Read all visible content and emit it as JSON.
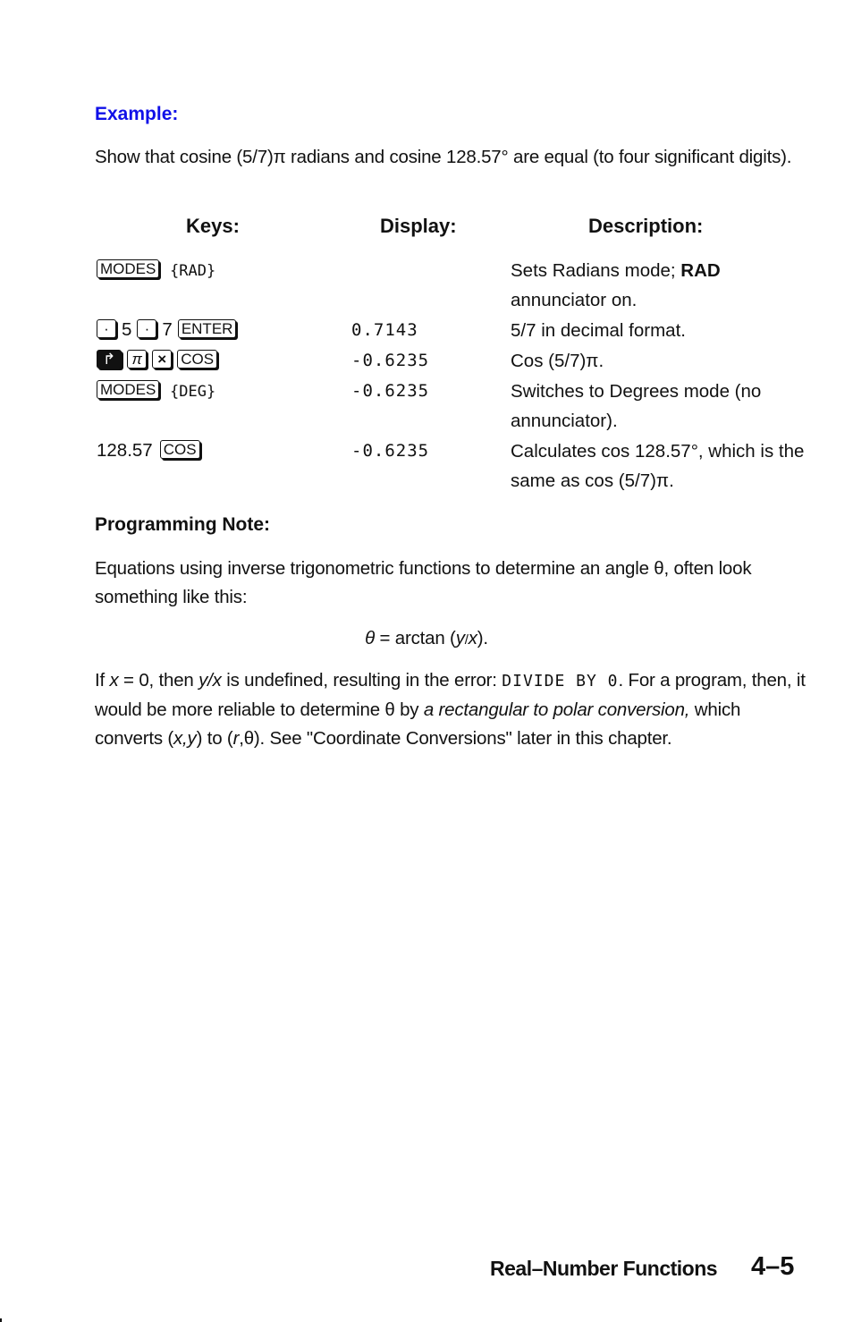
{
  "example": {
    "heading": "Example:",
    "intro": "Show that cosine (5/7)π radians and cosine 128.57° are equal (to four significant digits).",
    "accent_color": "#1010e8"
  },
  "table": {
    "headers": {
      "keys": "Keys:",
      "display": "Display:",
      "description": "Description:"
    },
    "rows": [
      {
        "keys": [
          {
            "type": "keycap",
            "label": "MODES"
          },
          {
            "type": "softkey",
            "label": "{RAD}"
          }
        ],
        "display": "",
        "description_pre": "Sets Radians mode; ",
        "description_bold": "RAD",
        "description_post": " annunciator on."
      },
      {
        "keys": [
          {
            "type": "keycap",
            "label": "·"
          },
          {
            "type": "text",
            "label": "5"
          },
          {
            "type": "keycap",
            "label": "·"
          },
          {
            "type": "text",
            "label": "7"
          },
          {
            "type": "keycap",
            "label": "ENTER"
          }
        ],
        "display": "0.7143",
        "description": "5/7 in decimal format."
      },
      {
        "keys": [
          {
            "type": "keycap-shift",
            "label": "↱",
            "icon": "right-shift-icon"
          },
          {
            "type": "keycap",
            "label": "π"
          },
          {
            "type": "keycap",
            "label": "×"
          },
          {
            "type": "keycap",
            "label": "COS"
          }
        ],
        "display": "-0.6235",
        "description": "Cos (5/7)π."
      },
      {
        "keys": [
          {
            "type": "keycap",
            "label": "MODES"
          },
          {
            "type": "softkey",
            "label": "{DEG}"
          }
        ],
        "display": "-0.6235",
        "description": "Switches to Degrees mode (no annunciator)."
      },
      {
        "keys": [
          {
            "type": "text",
            "label": "128.57"
          },
          {
            "type": "keycap",
            "label": "COS"
          }
        ],
        "display": "-0.6235",
        "description": "Calculates cos 128.57°, which is the same as cos (5/7)π."
      }
    ]
  },
  "programming_note": {
    "heading": "Programming Note:",
    "p1": "Equations using inverse trigonometric functions to determine an angle θ, often look something like this:",
    "equation": {
      "theta": "θ",
      "rest_pre": " = arctan (",
      "y": "y",
      "slash": "/",
      "x": "x",
      "rest_post": ")."
    },
    "p2": {
      "t1": "If ",
      "x1": "x",
      "t2": " = 0, then ",
      "yx": "y/x",
      "t3": " is undefined, resulting in the error: ",
      "error": "DIVIDE BY 0",
      "t4": ". For a program, then, it would be more reliable to determine θ by ",
      "italic": "a rectangular to polar conversion,",
      "t5": " which converts (",
      "xy": "x,y",
      "t6": ") to (",
      "r": "r",
      "t7": ",θ). See \"Coordinate Conversions\" later in this chapter."
    }
  },
  "footer": {
    "chapter_title": "Real–Number Functions",
    "page_number": "4–5"
  }
}
